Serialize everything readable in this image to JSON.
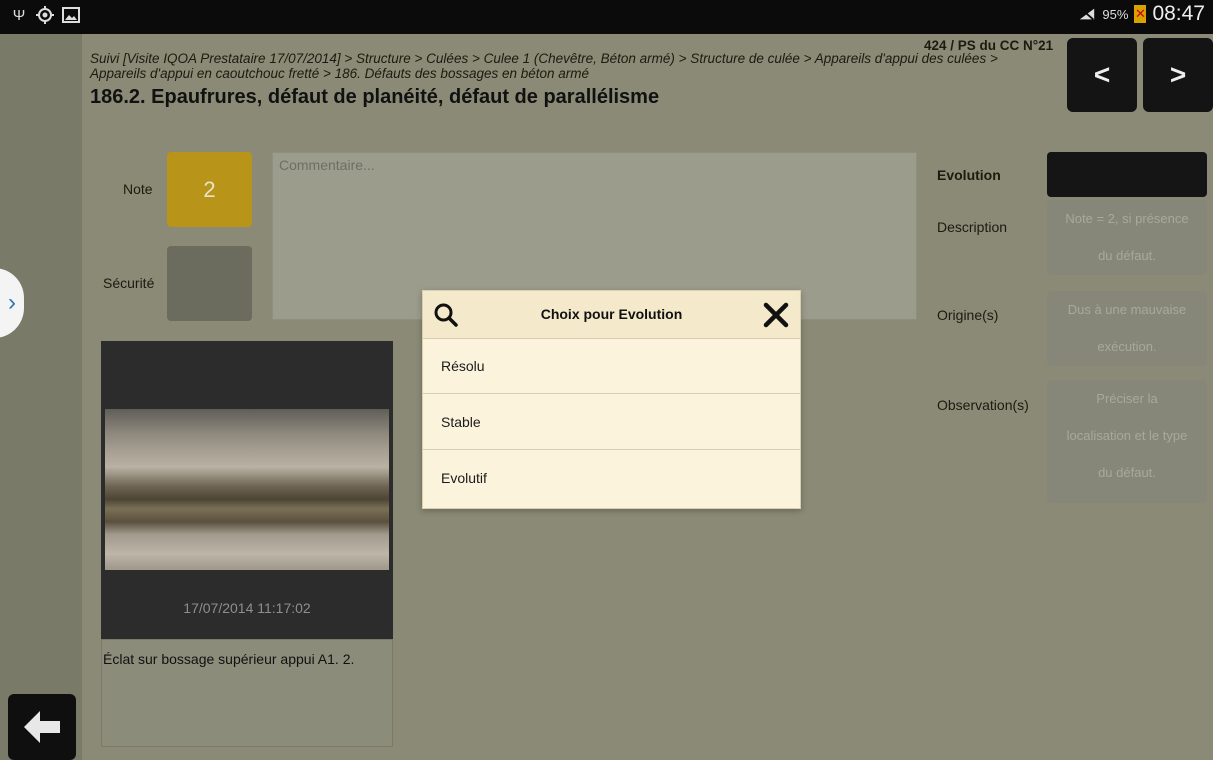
{
  "statusbar": {
    "left_icons": [
      "usb-icon",
      "gps-icon",
      "image-icon"
    ],
    "battery": "95%",
    "time": "08:47"
  },
  "header": {
    "breadcrumb": "Suivi [Visite IQOA Prestataire 17/07/2014] > Structure > Culées > Culee 1 (Chevêtre, Béton armé) > Structure de culée > Appareils d'appui des culées > Appareils d'appui en caoutchouc fretté > 186. Défauts des bossages en béton armé",
    "reference": "424 / PS du CC N°21",
    "title": "186.2. Epaufrures, défaut de planéité, défaut de parallélisme",
    "prev_label": "<",
    "next_label": ">"
  },
  "form": {
    "note_label": "Note",
    "note_value": "2",
    "securite_label": "Sécurité",
    "comment_placeholder": "Commentaire...",
    "evolution_label": "Evolution",
    "description_label": "Description",
    "description_value": [
      "Note = 2, si présence",
      "du défaut."
    ],
    "origines_label": "Origine(s)",
    "origines_value": [
      "Dus à une mauvaise",
      "exécution."
    ],
    "observations_label": "Observation(s)",
    "observations_value": [
      "Préciser la",
      "localisation et le type",
      "du défaut."
    ]
  },
  "photo": {
    "date": "17/07/2014 11:17:02",
    "caption": "Éclat sur bossage supérieur appui A1. 2."
  },
  "modal": {
    "title": "Choix pour Evolution",
    "options": [
      "Résolu",
      "Stable",
      "Evolutif"
    ]
  },
  "colors": {
    "note_accent": "#b89518",
    "modal_bg": "#fbf3dc"
  }
}
